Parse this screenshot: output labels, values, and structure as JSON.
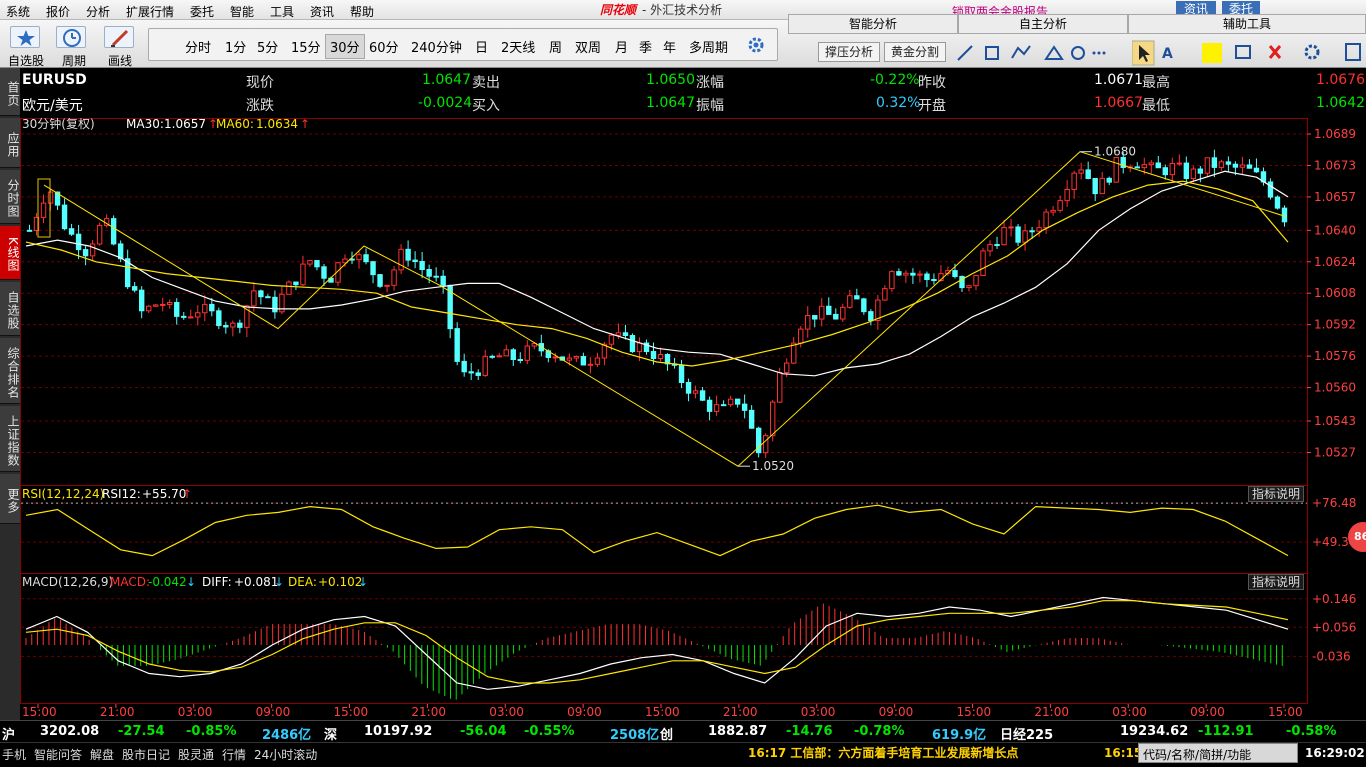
{
  "menu": [
    "系统",
    "报价",
    "分析",
    "扩展行情",
    "委托",
    "智能",
    "工具",
    "资讯",
    "帮助"
  ],
  "app": {
    "logo": "同花顺",
    "title": "- 外汇技术分析"
  },
  "marquee": "锁取两会金股报告",
  "right_top_buttons": {
    "news": "资讯",
    "trade": "委托"
  },
  "toolbar": {
    "watchlist": "自选股",
    "cycle": "周期",
    "draw": "画线"
  },
  "periods": [
    "分时",
    "1分",
    "5分",
    "15分",
    "30分",
    "60分",
    "240分钟",
    "日",
    "2天线",
    "周",
    "双周",
    "月",
    "季",
    "年",
    "多周期"
  ],
  "active_period": "30分",
  "panels": {
    "smart": "智能分析",
    "custom": "自主分析",
    "assist": "辅助工具",
    "support_btn": "撑压分析",
    "golden_btn": "黄金分割"
  },
  "left_nav": [
    "首页",
    "应用",
    "分时图",
    "K线图",
    "自选股",
    "综合排名",
    "上证指数",
    "更多"
  ],
  "active_nav": "K线图",
  "quote": {
    "symbol": "EURUSD",
    "name": "欧元/美元",
    "now_label": "现价",
    "now": "1.0647",
    "sell_label": "卖出",
    "sell": "1.0650",
    "change_pct_label": "涨幅",
    "change_pct": "-0.22%",
    "prev_label": "昨收",
    "prev": "1.0671",
    "high_label": "最高",
    "high": "1.0676",
    "change_label": "涨跌",
    "change": "-0.0024",
    "buy_label": "买入",
    "buy": "1.0647",
    "amp_label": "振幅",
    "amp": "0.32%",
    "open_label": "开盘",
    "open": "1.0667",
    "low_label": "最低",
    "low": "1.0642"
  },
  "kline_header": {
    "period": "30分钟(复权)",
    "ma30_label": "MA30:",
    "ma30": "1.0657",
    "ma60_label": "MA60:",
    "ma60": "1.0634"
  },
  "rsi_header": {
    "name": "RSI(12,12,24)",
    "rsi12_label": "RSI12:",
    "rsi12": "+55.70"
  },
  "macd_header": {
    "name": "MACD(12,26,9)",
    "macd_label": "MACD:",
    "macd": "-0.042",
    "diff_label": "DIFF:",
    "diff": "+0.081",
    "dea_label": "DEA:",
    "dea": "+0.102"
  },
  "explain_label": "指标说明",
  "badge": "86",
  "chart_data": {
    "type": "candlestick",
    "price_axis": [
      "1.0689",
      "1.0673",
      "1.0657",
      "1.0640",
      "1.0624",
      "1.0608",
      "1.0592",
      "1.0576",
      "1.0560",
      "1.0543",
      "1.0527"
    ],
    "rsi_axis": [
      "+76.48",
      "+49.34"
    ],
    "macd_axis": [
      "+0.146",
      "+0.056",
      "-0.036"
    ],
    "time_axis": [
      "15:00",
      "21:00",
      "03:00",
      "09:00",
      "15:00",
      "21:00",
      "03:00",
      "09:00",
      "15:00",
      "21:00",
      "03:00",
      "09:00",
      "15:00",
      "21:00",
      "03:00",
      "09:00",
      "15:00"
    ],
    "ylim": [
      1.0514,
      1.0689
    ],
    "annotations": {
      "high_label": "1.0680",
      "high": 1.068,
      "low_label": "1.0520",
      "low": 1.052
    },
    "price_path": [
      1.064,
      1.0663,
      1.064,
      1.063,
      1.0645,
      1.062,
      1.0598,
      1.0604,
      1.0595,
      1.06,
      1.0596,
      1.059,
      1.061,
      1.06,
      1.0613,
      1.0625,
      1.0615,
      1.0631,
      1.0622,
      1.0612,
      1.063,
      1.062,
      1.0612,
      1.0565,
      1.057,
      1.0576,
      1.0575,
      1.058,
      1.0578,
      1.0572,
      1.0575,
      1.0587,
      1.0582,
      1.058,
      1.0572,
      1.0562,
      1.0552,
      1.0548,
      1.0555,
      1.0525,
      1.0565,
      1.0592,
      1.0598,
      1.0596,
      1.0605,
      1.0597,
      1.0622,
      1.0618,
      1.0615,
      1.062,
      1.0606,
      1.063,
      1.064,
      1.0635,
      1.0645,
      1.0658,
      1.0675,
      1.066,
      1.0673,
      1.0676,
      1.067,
      1.0672,
      1.0668,
      1.0674,
      1.0672,
      1.0671,
      1.0664,
      1.0647
    ],
    "ma30_path": [
      1.0632,
      1.0635,
      1.0632,
      1.0626,
      1.0616,
      1.061,
      1.0604,
      1.0601,
      1.06,
      1.06,
      1.0602,
      1.0605,
      1.0609,
      1.0611,
      1.0613,
      1.0613,
      1.0606,
      1.0598,
      1.059,
      1.0585,
      1.058,
      1.0578,
      1.0577,
      1.0572,
      1.0567,
      1.0566,
      1.057,
      1.0572,
      1.0577,
      1.0586,
      1.0596,
      1.0603,
      1.0611,
      1.0623,
      1.064,
      1.0651,
      1.066,
      1.0665,
      1.067,
      1.0667,
      1.0657
    ],
    "ma60_path": [
      1.0634,
      1.063,
      1.0624,
      1.0621,
      1.0618,
      1.0616,
      1.0614,
      1.0612,
      1.0611,
      1.061,
      1.0608,
      1.0601,
      1.0598,
      1.0595,
      1.0592,
      1.059,
      1.0585,
      1.0578,
      1.0573,
      1.0571,
      1.0574,
      1.0578,
      1.0582,
      1.0587,
      1.0593,
      1.06,
      1.0608,
      1.0618,
      1.0627,
      1.064,
      1.0649,
      1.0657,
      1.0663,
      1.0665,
      1.0661,
      1.0655,
      1.0634
    ],
    "zigzag": [
      1.0663,
      1.059,
      1.0632,
      1.0612,
      1.052,
      1.068,
      1.0647
    ],
    "rsi_path": [
      68,
      72,
      58,
      44,
      40,
      51,
      63,
      68,
      70,
      74,
      72,
      60,
      52,
      45,
      46,
      58,
      60,
      58,
      42,
      50,
      56,
      48,
      40,
      50,
      55,
      66,
      72,
      75,
      70,
      72,
      62,
      55,
      74,
      73,
      72,
      70,
      73,
      72,
      64,
      52,
      40
    ],
    "diff_path": [
      0.05,
      0.09,
      0.04,
      -0.05,
      -0.09,
      -0.1,
      -0.09,
      -0.06,
      0.0,
      0.05,
      0.08,
      0.09,
      0.06,
      -0.03,
      -0.12,
      -0.14,
      -0.13,
      -0.11,
      -0.09,
      -0.06,
      -0.04,
      -0.03,
      -0.05,
      -0.09,
      -0.12,
      -0.04,
      0.06,
      0.1,
      0.09,
      0.1,
      0.12,
      0.11,
      0.09,
      0.11,
      0.13,
      0.15,
      0.14,
      0.13,
      0.12,
      0.11,
      0.08,
      0.05
    ],
    "dea_path": [
      0.04,
      0.05,
      0.03,
      -0.02,
      -0.06,
      -0.08,
      -0.085,
      -0.07,
      -0.03,
      0.02,
      0.05,
      0.07,
      0.07,
      0.03,
      -0.04,
      -0.1,
      -0.12,
      -0.12,
      -0.11,
      -0.09,
      -0.07,
      -0.05,
      -0.05,
      -0.07,
      -0.09,
      -0.07,
      0.0,
      0.06,
      0.08,
      0.09,
      0.1,
      0.1,
      0.1,
      0.11,
      0.12,
      0.14,
      0.14,
      0.13,
      0.125,
      0.12,
      0.1,
      0.08
    ]
  },
  "status": {
    "sh_label": "沪",
    "sh_index": "3202.08",
    "sh_chg": "-27.54",
    "sh_pct": "-0.85%",
    "sh_vol": "2486亿",
    "sz_label": "深",
    "sz_index": "10197.92",
    "sz_chg": "-56.04",
    "sz_pct": "-0.55%",
    "sz_vol": "2508亿",
    "cy_label": "创",
    "cy_index": "1882.87",
    "cy_chg": "-14.76",
    "cy_pct": "-0.78%",
    "cy_vol": "619.9亿",
    "nk_label": "日经225",
    "nk_index": "19234.62",
    "nk_chg": "-112.91",
    "nk_pct": "-0.58%"
  },
  "bottom": {
    "items": [
      "手机",
      "智能问答",
      "解盘",
      "股市日记",
      "股灵通",
      "行情",
      "24小时滚动"
    ],
    "news": "16:17 工信部：六方面着手培育工业发展新增长点",
    "news_time2": "16:15",
    "search_placeholder": "代码/名称/简拼/功能",
    "clock": "16:29:02"
  }
}
